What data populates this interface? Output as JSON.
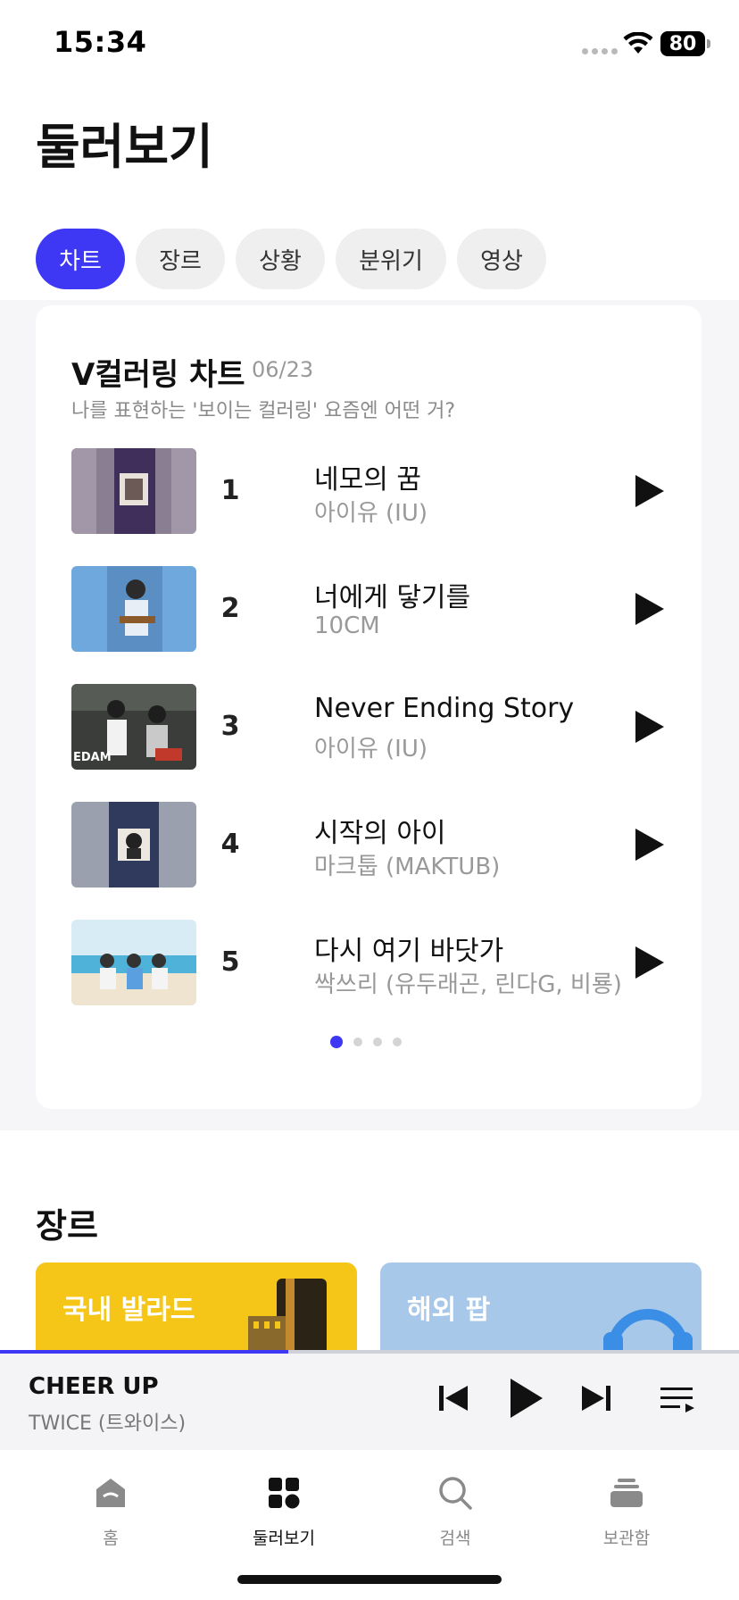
{
  "status": {
    "time": "15:34",
    "battery": "80"
  },
  "page_title": "둘러보기",
  "chips": [
    {
      "label": "차트",
      "active": true
    },
    {
      "label": "장르",
      "active": false
    },
    {
      "label": "상황",
      "active": false
    },
    {
      "label": "분위기",
      "active": false
    },
    {
      "label": "영상",
      "active": false
    }
  ],
  "chart": {
    "title": "V컬러링 차트",
    "date": "06/23",
    "subtitle": "나를 표현하는 '보이는 컬러링' 요즘엔 어떤 거?",
    "tracks": [
      {
        "rank": "1",
        "title": "네모의 꿈",
        "artist": "아이유 (IU)"
      },
      {
        "rank": "2",
        "title": "너에게 닿기를",
        "artist": "10CM"
      },
      {
        "rank": "3",
        "title": "Never Ending Story",
        "artist": "아이유 (IU)"
      },
      {
        "rank": "4",
        "title": "시작의 아이",
        "artist": "마크툽 (MAKTUB)"
      },
      {
        "rank": "5",
        "title": "다시 여기 바닷가",
        "artist": "싹쓰리 (유두래곤, 린다G, 비룡)"
      }
    ],
    "pages": 4,
    "current_page": 1
  },
  "genre": {
    "title": "장르",
    "cards": [
      {
        "label": "국내 발라드",
        "color": "#f5c518"
      },
      {
        "label": "해외 팝",
        "color": "#a8c8ea"
      }
    ]
  },
  "now_playing": {
    "title": "CHEER UP",
    "artist": "TWICE (트와이스)",
    "progress": 0.39
  },
  "tabs": [
    {
      "label": "홈",
      "icon": "home-icon",
      "active": false
    },
    {
      "label": "둘러보기",
      "icon": "browse-icon",
      "active": true
    },
    {
      "label": "검색",
      "icon": "search-icon",
      "active": false
    },
    {
      "label": "보관함",
      "icon": "library-icon",
      "active": false
    }
  ],
  "colors": {
    "accent": "#3e38f5",
    "chip_bg": "#efefef"
  }
}
